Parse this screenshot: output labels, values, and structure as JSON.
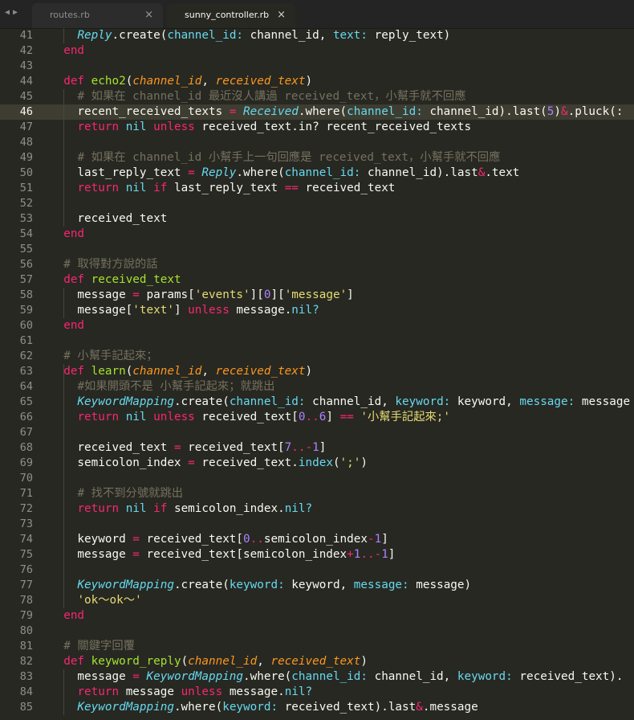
{
  "tabs": [
    {
      "label": "routes.rb",
      "close": "×",
      "active": false
    },
    {
      "label": "sunny_controller.rb",
      "close": "×",
      "active": true
    }
  ],
  "nav": {
    "back_icon": "◀",
    "forward_icon": "▶"
  },
  "colors": {
    "background": "#272822",
    "keyword": "#f92672",
    "constant": "#66d9ef",
    "string": "#e6db74",
    "number": "#ae81ff",
    "comment": "#75715e",
    "function": "#a6e22e",
    "parameter": "#fd971f",
    "text": "#f8f8f2"
  },
  "lines": [
    {
      "n": "41",
      "t": [
        [
          "    ",
          ""
        ],
        [
          "Reply",
          "cons"
        ],
        [
          ".create(",
          ""
        ],
        [
          "channel_id:",
          "sym"
        ],
        [
          " channel_id, ",
          ""
        ],
        [
          "text:",
          "sym"
        ],
        [
          " reply_text)",
          ""
        ]
      ]
    },
    {
      "n": "42",
      "t": [
        [
          "  ",
          ""
        ],
        [
          "end",
          "kw"
        ]
      ]
    },
    {
      "n": "43",
      "t": []
    },
    {
      "n": "44",
      "t": [
        [
          "  ",
          ""
        ],
        [
          "def",
          "kw"
        ],
        [
          " ",
          ""
        ],
        [
          "echo2",
          "fn"
        ],
        [
          "(",
          ""
        ],
        [
          "channel_id",
          "param"
        ],
        [
          ", ",
          ""
        ],
        [
          "received_text",
          "param"
        ],
        [
          ")",
          ""
        ]
      ]
    },
    {
      "n": "45",
      "t": [
        [
          "    ",
          ""
        ],
        [
          "# 如果在 channel_id 最近沒人講過 received_text，小幫手就不回應",
          "cm"
        ]
      ]
    },
    {
      "n": "46",
      "cur": true,
      "t": [
        [
          "    recent_received_texts ",
          ""
        ],
        [
          "=",
          "kw"
        ],
        [
          " ",
          ""
        ],
        [
          "Received",
          "cons"
        ],
        [
          ".where(",
          ""
        ],
        [
          "channel_id:",
          "sym"
        ],
        [
          " channel_id).last(",
          ""
        ],
        [
          "5",
          "num"
        ],
        [
          ")",
          ""
        ],
        [
          "&",
          "kw"
        ],
        [
          ".pluck(:",
          ""
        ]
      ]
    },
    {
      "n": "47",
      "t": [
        [
          "    ",
          ""
        ],
        [
          "return",
          "kw"
        ],
        [
          " ",
          ""
        ],
        [
          "nil",
          "sym"
        ],
        [
          " ",
          ""
        ],
        [
          "unless",
          "kw"
        ],
        [
          " received_text.in? recent_received_texts",
          ""
        ]
      ]
    },
    {
      "n": "48",
      "t": []
    },
    {
      "n": "49",
      "t": [
        [
          "    ",
          ""
        ],
        [
          "# 如果在 channel_id 小幫手上一句回應是 received_text，小幫手就不回應",
          "cm"
        ]
      ]
    },
    {
      "n": "50",
      "t": [
        [
          "    last_reply_text ",
          ""
        ],
        [
          "=",
          "kw"
        ],
        [
          " ",
          ""
        ],
        [
          "Reply",
          "cons"
        ],
        [
          ".where(",
          ""
        ],
        [
          "channel_id:",
          "sym"
        ],
        [
          " channel_id).last",
          ""
        ],
        [
          "&",
          "kw"
        ],
        [
          ".text",
          ""
        ]
      ]
    },
    {
      "n": "51",
      "t": [
        [
          "    ",
          ""
        ],
        [
          "return",
          "kw"
        ],
        [
          " ",
          ""
        ],
        [
          "nil",
          "sym"
        ],
        [
          " ",
          ""
        ],
        [
          "if",
          "kw"
        ],
        [
          " last_reply_text ",
          ""
        ],
        [
          "==",
          "kw"
        ],
        [
          " received_text",
          ""
        ]
      ]
    },
    {
      "n": "52",
      "t": []
    },
    {
      "n": "53",
      "t": [
        [
          "    received_text",
          ""
        ]
      ]
    },
    {
      "n": "54",
      "t": [
        [
          "  ",
          ""
        ],
        [
          "end",
          "kw"
        ]
      ]
    },
    {
      "n": "55",
      "t": []
    },
    {
      "n": "56",
      "t": [
        [
          "  ",
          ""
        ],
        [
          "# 取得對方說的話",
          "cm"
        ]
      ]
    },
    {
      "n": "57",
      "t": [
        [
          "  ",
          ""
        ],
        [
          "def",
          "kw"
        ],
        [
          " ",
          ""
        ],
        [
          "received_text",
          "fn"
        ]
      ]
    },
    {
      "n": "58",
      "t": [
        [
          "    message ",
          ""
        ],
        [
          "=",
          "kw"
        ],
        [
          " params[",
          ""
        ],
        [
          "'events'",
          "str"
        ],
        [
          "][",
          ""
        ],
        [
          "0",
          "num"
        ],
        [
          "][",
          ""
        ],
        [
          "'message'",
          "str"
        ],
        [
          "]",
          ""
        ]
      ]
    },
    {
      "n": "59",
      "t": [
        [
          "    message[",
          ""
        ],
        [
          "'text'",
          "str"
        ],
        [
          "] ",
          ""
        ],
        [
          "unless",
          "kw"
        ],
        [
          " message.",
          ""
        ],
        [
          "nil?",
          "sym"
        ]
      ]
    },
    {
      "n": "60",
      "t": [
        [
          "  ",
          ""
        ],
        [
          "end",
          "kw"
        ]
      ]
    },
    {
      "n": "61",
      "t": []
    },
    {
      "n": "62",
      "t": [
        [
          "  ",
          ""
        ],
        [
          "# 小幫手記起來；",
          "cm"
        ]
      ]
    },
    {
      "n": "63",
      "t": [
        [
          "  ",
          ""
        ],
        [
          "def",
          "kw"
        ],
        [
          " ",
          ""
        ],
        [
          "learn",
          "fn"
        ],
        [
          "(",
          ""
        ],
        [
          "channel_id",
          "param"
        ],
        [
          ", ",
          ""
        ],
        [
          "received_text",
          "param"
        ],
        [
          ")",
          ""
        ]
      ]
    },
    {
      "n": "64",
      "t": [
        [
          "    ",
          ""
        ],
        [
          "#如果開頭不是 小幫手記起來；就跳出",
          "cm"
        ]
      ]
    },
    {
      "n": "65",
      "t": [
        [
          "    ",
          ""
        ],
        [
          "KeywordMapping",
          "cons"
        ],
        [
          ".create(",
          ""
        ],
        [
          "channel_id:",
          "sym"
        ],
        [
          " channel_id, ",
          ""
        ],
        [
          "keyword:",
          "sym"
        ],
        [
          " keyword, ",
          ""
        ],
        [
          "message:",
          "sym"
        ],
        [
          " message",
          ""
        ]
      ]
    },
    {
      "n": "66",
      "t": [
        [
          "    ",
          ""
        ],
        [
          "return",
          "kw"
        ],
        [
          " ",
          ""
        ],
        [
          "nil",
          "sym"
        ],
        [
          " ",
          ""
        ],
        [
          "unless",
          "kw"
        ],
        [
          " received_text[",
          ""
        ],
        [
          "0",
          "num"
        ],
        [
          "..",
          "kw"
        ],
        [
          "6",
          "num"
        ],
        [
          "] ",
          ""
        ],
        [
          "==",
          "kw"
        ],
        [
          " ",
          ""
        ],
        [
          "'小幫手記起來;'",
          "str"
        ]
      ]
    },
    {
      "n": "67",
      "t": []
    },
    {
      "n": "68",
      "t": [
        [
          "    received_text ",
          ""
        ],
        [
          "=",
          "kw"
        ],
        [
          " received_text[",
          ""
        ],
        [
          "7",
          "num"
        ],
        [
          "..-",
          "kw"
        ],
        [
          "1",
          "num"
        ],
        [
          "]",
          ""
        ]
      ]
    },
    {
      "n": "69",
      "t": [
        [
          "    semicolon_index ",
          ""
        ],
        [
          "=",
          "kw"
        ],
        [
          " received_text.",
          ""
        ],
        [
          "index",
          "sym"
        ],
        [
          "(",
          ""
        ],
        [
          "';'",
          "str"
        ],
        [
          ")",
          ""
        ]
      ]
    },
    {
      "n": "70",
      "t": []
    },
    {
      "n": "71",
      "t": [
        [
          "    ",
          ""
        ],
        [
          "# 找不到分號就跳出",
          "cm"
        ]
      ]
    },
    {
      "n": "72",
      "t": [
        [
          "    ",
          ""
        ],
        [
          "return",
          "kw"
        ],
        [
          " ",
          ""
        ],
        [
          "nil",
          "sym"
        ],
        [
          " ",
          ""
        ],
        [
          "if",
          "kw"
        ],
        [
          " semicolon_index.",
          ""
        ],
        [
          "nil?",
          "sym"
        ]
      ]
    },
    {
      "n": "73",
      "t": []
    },
    {
      "n": "74",
      "t": [
        [
          "    keyword ",
          ""
        ],
        [
          "=",
          "kw"
        ],
        [
          " received_text[",
          ""
        ],
        [
          "0",
          "num"
        ],
        [
          "..",
          "kw"
        ],
        [
          "semicolon_index",
          ""
        ],
        [
          "-",
          "kw"
        ],
        [
          "1",
          "num"
        ],
        [
          "]",
          ""
        ]
      ]
    },
    {
      "n": "75",
      "t": [
        [
          "    message ",
          ""
        ],
        [
          "=",
          "kw"
        ],
        [
          " received_text[semicolon_index",
          ""
        ],
        [
          "+",
          "kw"
        ],
        [
          "1",
          "num"
        ],
        [
          "..-",
          "kw"
        ],
        [
          "1",
          "num"
        ],
        [
          "]",
          ""
        ]
      ]
    },
    {
      "n": "76",
      "t": []
    },
    {
      "n": "77",
      "t": [
        [
          "    ",
          ""
        ],
        [
          "KeywordMapping",
          "cons"
        ],
        [
          ".create(",
          ""
        ],
        [
          "keyword:",
          "sym"
        ],
        [
          " keyword, ",
          ""
        ],
        [
          "message:",
          "sym"
        ],
        [
          " message)",
          ""
        ]
      ]
    },
    {
      "n": "78",
      "t": [
        [
          "    ",
          ""
        ],
        [
          "'ok～ok～'",
          "str"
        ]
      ]
    },
    {
      "n": "79",
      "t": [
        [
          "  ",
          ""
        ],
        [
          "end",
          "kw"
        ]
      ]
    },
    {
      "n": "80",
      "t": []
    },
    {
      "n": "81",
      "t": [
        [
          "  ",
          ""
        ],
        [
          "# 關鍵字回覆",
          "cm"
        ]
      ]
    },
    {
      "n": "82",
      "t": [
        [
          "  ",
          ""
        ],
        [
          "def",
          "kw"
        ],
        [
          " ",
          ""
        ],
        [
          "keyword_reply",
          "fn"
        ],
        [
          "(",
          ""
        ],
        [
          "channel_id",
          "param"
        ],
        [
          ", ",
          ""
        ],
        [
          "received_text",
          "param"
        ],
        [
          ")",
          ""
        ]
      ]
    },
    {
      "n": "83",
      "t": [
        [
          "    message ",
          ""
        ],
        [
          "=",
          "kw"
        ],
        [
          " ",
          ""
        ],
        [
          "KeywordMapping",
          "cons"
        ],
        [
          ".where(",
          ""
        ],
        [
          "channel_id:",
          "sym"
        ],
        [
          " channel_id, ",
          ""
        ],
        [
          "keyword:",
          "sym"
        ],
        [
          " received_text).",
          ""
        ]
      ]
    },
    {
      "n": "84",
      "t": [
        [
          "    ",
          ""
        ],
        [
          "return",
          "kw"
        ],
        [
          " message ",
          ""
        ],
        [
          "unless",
          "kw"
        ],
        [
          " message.",
          ""
        ],
        [
          "nil?",
          "sym"
        ]
      ]
    },
    {
      "n": "85",
      "t": [
        [
          "    ",
          ""
        ],
        [
          "KeywordMapping",
          "cons"
        ],
        [
          ".where(",
          ""
        ],
        [
          "keyword:",
          "sym"
        ],
        [
          " received_text).last",
          ""
        ],
        [
          "&",
          "kw"
        ],
        [
          ".message",
          ""
        ]
      ]
    }
  ]
}
